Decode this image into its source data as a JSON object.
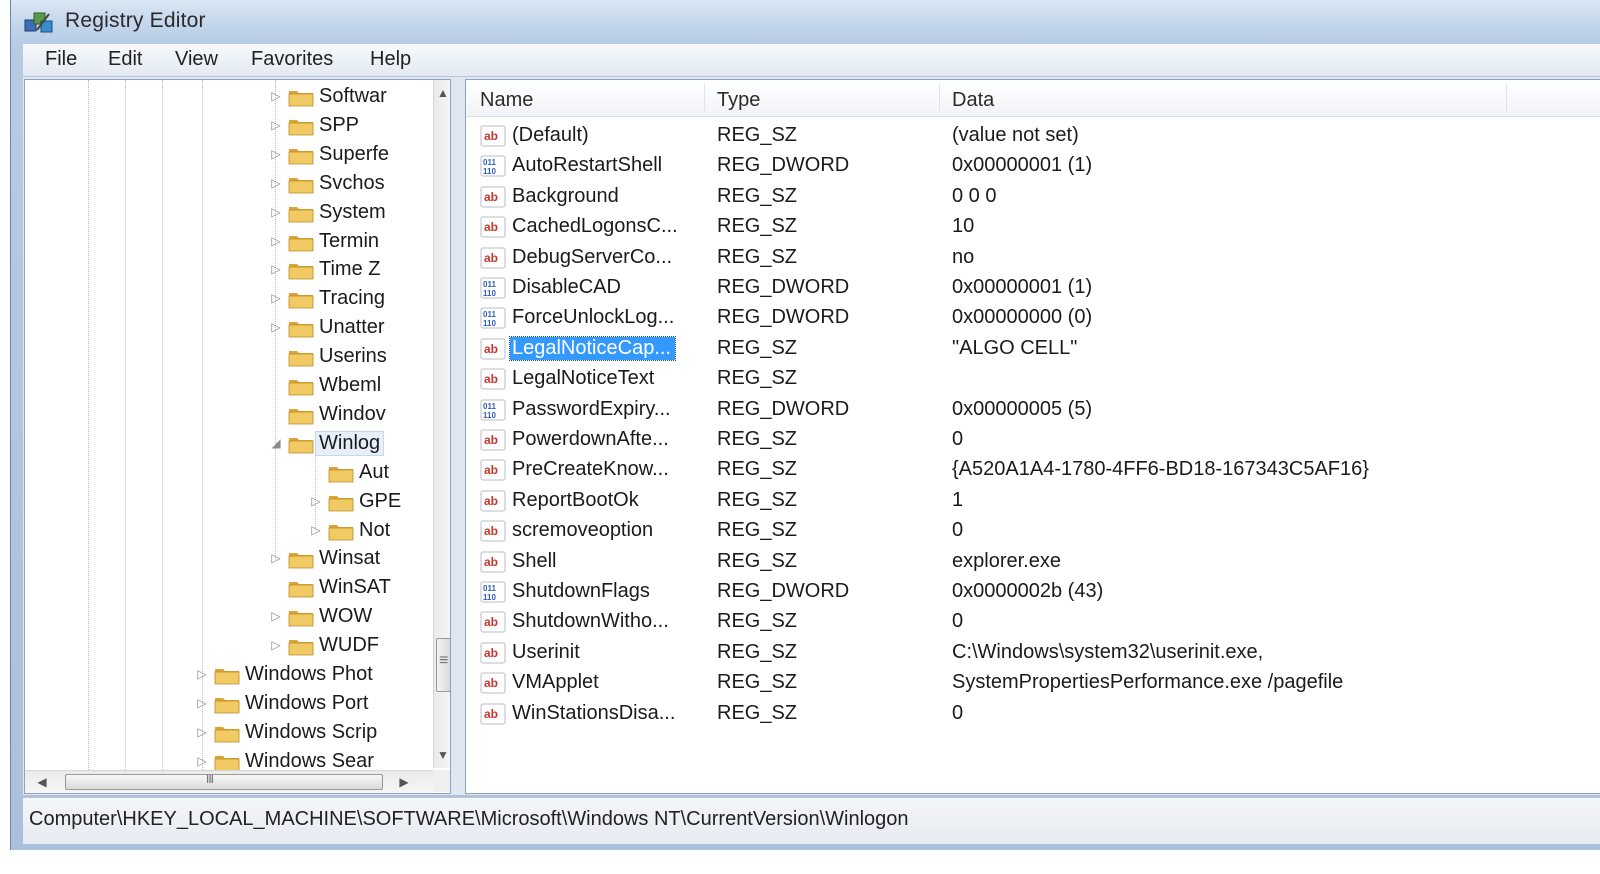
{
  "window": {
    "title": "Registry Editor"
  },
  "menu": [
    "File",
    "Edit",
    "View",
    "Favorites",
    "Help"
  ],
  "tree": {
    "items": [
      {
        "label": "Softwar",
        "level": 2,
        "expander": "▷"
      },
      {
        "label": "SPP",
        "level": 2,
        "expander": "▷"
      },
      {
        "label": "Superfe",
        "level": 2,
        "expander": "▷"
      },
      {
        "label": "Svchos",
        "level": 2,
        "expander": "▷"
      },
      {
        "label": "System",
        "level": 2,
        "expander": "▷"
      },
      {
        "label": "Termin",
        "level": 2,
        "expander": "▷"
      },
      {
        "label": "Time Z",
        "level": 2,
        "expander": "▷"
      },
      {
        "label": "Tracing",
        "level": 2,
        "expander": "▷"
      },
      {
        "label": "Unatter",
        "level": 2,
        "expander": "▷"
      },
      {
        "label": "Userins",
        "level": 2,
        "expander": ""
      },
      {
        "label": "Wbeml",
        "level": 2,
        "expander": ""
      },
      {
        "label": "Windov",
        "level": 2,
        "expander": ""
      },
      {
        "label": "Winlog",
        "level": 2,
        "expander": "◢",
        "selected": true
      },
      {
        "label": "Aut",
        "level": 3,
        "expander": ""
      },
      {
        "label": "GPE",
        "level": 3,
        "expander": "▷"
      },
      {
        "label": "Not",
        "level": 3,
        "expander": "▷"
      },
      {
        "label": "Winsat",
        "level": 2,
        "expander": "▷"
      },
      {
        "label": "WinSAT",
        "level": 2,
        "expander": ""
      },
      {
        "label": "WOW",
        "level": 2,
        "expander": "▷"
      },
      {
        "label": "WUDF",
        "level": 2,
        "expander": "▷"
      },
      {
        "label": "Windows Phot",
        "level": 1,
        "expander": "▷"
      },
      {
        "label": "Windows Port",
        "level": 1,
        "expander": "▷"
      },
      {
        "label": "Windows Scrip",
        "level": 1,
        "expander": "▷"
      },
      {
        "label": "Windows Sear",
        "level": 1,
        "expander": "▷"
      }
    ],
    "scroll_grip": "≡",
    "hscroll_grip": "III"
  },
  "list": {
    "columns": [
      "Name",
      "Type",
      "Data"
    ],
    "rows": [
      {
        "icon": "string",
        "name": "(Default)",
        "type": "REG_SZ",
        "data": "(value not set)"
      },
      {
        "icon": "binary",
        "name": "AutoRestartShell",
        "type": "REG_DWORD",
        "data": "0x00000001 (1)"
      },
      {
        "icon": "string",
        "name": "Background",
        "type": "REG_SZ",
        "data": "0 0 0"
      },
      {
        "icon": "string",
        "name": "CachedLogonsC...",
        "type": "REG_SZ",
        "data": "10"
      },
      {
        "icon": "string",
        "name": "DebugServerCo...",
        "type": "REG_SZ",
        "data": "no"
      },
      {
        "icon": "binary",
        "name": "DisableCAD",
        "type": "REG_DWORD",
        "data": "0x00000001 (1)"
      },
      {
        "icon": "binary",
        "name": "ForceUnlockLog...",
        "type": "REG_DWORD",
        "data": "0x00000000 (0)"
      },
      {
        "icon": "string",
        "name": "LegalNoticeCap...",
        "type": "REG_SZ",
        "data": "\"ALGO CELL\"",
        "selected": true
      },
      {
        "icon": "string",
        "name": "LegalNoticeText",
        "type": "REG_SZ",
        "data": ""
      },
      {
        "icon": "binary",
        "name": "PasswordExpiry...",
        "type": "REG_DWORD",
        "data": "0x00000005 (5)"
      },
      {
        "icon": "string",
        "name": "PowerdownAfte...",
        "type": "REG_SZ",
        "data": "0"
      },
      {
        "icon": "string",
        "name": "PreCreateKnow...",
        "type": "REG_SZ",
        "data": "{A520A1A4-1780-4FF6-BD18-167343C5AF16}"
      },
      {
        "icon": "string",
        "name": "ReportBootOk",
        "type": "REG_SZ",
        "data": "1"
      },
      {
        "icon": "string",
        "name": "scremoveoption",
        "type": "REG_SZ",
        "data": "0"
      },
      {
        "icon": "string",
        "name": "Shell",
        "type": "REG_SZ",
        "data": "explorer.exe"
      },
      {
        "icon": "binary",
        "name": "ShutdownFlags",
        "type": "REG_DWORD",
        "data": "0x0000002b (43)"
      },
      {
        "icon": "string",
        "name": "ShutdownWitho...",
        "type": "REG_SZ",
        "data": "0"
      },
      {
        "icon": "string",
        "name": "Userinit",
        "type": "REG_SZ",
        "data": "C:\\Windows\\system32\\userinit.exe,"
      },
      {
        "icon": "string",
        "name": "VMApplet",
        "type": "REG_SZ",
        "data": "SystemPropertiesPerformance.exe /pagefile"
      },
      {
        "icon": "string",
        "name": "WinStationsDisa...",
        "type": "REG_SZ",
        "data": "0"
      }
    ]
  },
  "status": {
    "path": "Computer\\HKEY_LOCAL_MACHINE\\SOFTWARE\\Microsoft\\Windows NT\\CurrentVersion\\Winlogon"
  },
  "colors": {
    "selection": "#3399ff",
    "folder": "#e8b84a"
  }
}
